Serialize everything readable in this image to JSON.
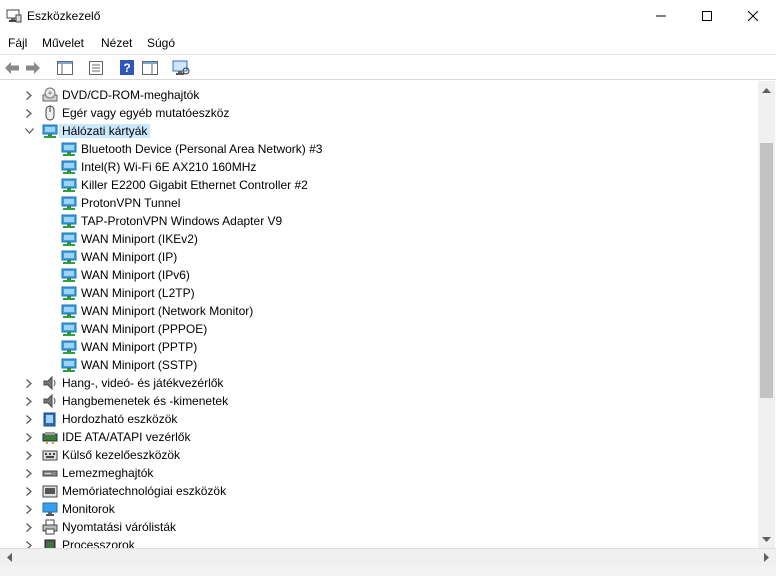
{
  "window": {
    "title": "Eszközkezelő"
  },
  "menu": {
    "file": "Fájl",
    "action": "Művelet",
    "view": "Nézet",
    "help": "Súgó"
  },
  "tree": [
    {
      "label": "DVD/CD-ROM-meghajtók",
      "level": 1,
      "expander": "collapsed",
      "icon": "dvd-drive-icon"
    },
    {
      "label": "Egér vagy egyéb mutatóeszköz",
      "level": 1,
      "expander": "collapsed",
      "icon": "mouse-icon"
    },
    {
      "label": "Hálózati kártyák",
      "level": 1,
      "expander": "expanded",
      "icon": "network-adapter-icon",
      "selected": true
    },
    {
      "label": "Bluetooth Device (Personal Area Network) #3",
      "level": 2,
      "icon": "network-adapter-icon"
    },
    {
      "label": "Intel(R) Wi-Fi 6E AX210 160MHz",
      "level": 2,
      "icon": "network-adapter-icon"
    },
    {
      "label": "Killer E2200 Gigabit Ethernet Controller #2",
      "level": 2,
      "icon": "network-adapter-icon"
    },
    {
      "label": "ProtonVPN Tunnel",
      "level": 2,
      "icon": "network-adapter-icon"
    },
    {
      "label": "TAP-ProtonVPN Windows Adapter V9",
      "level": 2,
      "icon": "network-adapter-icon"
    },
    {
      "label": "WAN Miniport (IKEv2)",
      "level": 2,
      "icon": "network-adapter-icon"
    },
    {
      "label": "WAN Miniport (IP)",
      "level": 2,
      "icon": "network-adapter-icon"
    },
    {
      "label": "WAN Miniport (IPv6)",
      "level": 2,
      "icon": "network-adapter-icon"
    },
    {
      "label": "WAN Miniport (L2TP)",
      "level": 2,
      "icon": "network-adapter-icon"
    },
    {
      "label": "WAN Miniport (Network Monitor)",
      "level": 2,
      "icon": "network-adapter-icon"
    },
    {
      "label": "WAN Miniport (PPPOE)",
      "level": 2,
      "icon": "network-adapter-icon"
    },
    {
      "label": "WAN Miniport (PPTP)",
      "level": 2,
      "icon": "network-adapter-icon"
    },
    {
      "label": "WAN Miniport (SSTP)",
      "level": 2,
      "icon": "network-adapter-icon"
    },
    {
      "label": "Hang-, videó- és játékvezérlők",
      "level": 1,
      "expander": "collapsed",
      "icon": "speaker-icon"
    },
    {
      "label": "Hangbemenetek és -kimenetek",
      "level": 1,
      "expander": "collapsed",
      "icon": "speaker-icon"
    },
    {
      "label": "Hordozható eszközök",
      "level": 1,
      "expander": "collapsed",
      "icon": "portable-device-icon"
    },
    {
      "label": "IDE ATA/ATAPI vezérlők",
      "level": 1,
      "expander": "collapsed",
      "icon": "ide-controller-icon"
    },
    {
      "label": "Külső kezelőeszközök",
      "level": 1,
      "expander": "collapsed",
      "icon": "keyboard-icon"
    },
    {
      "label": "Lemezmeghajtók",
      "level": 1,
      "expander": "collapsed",
      "icon": "disk-drive-icon"
    },
    {
      "label": "Memóriatechnológiai eszközök",
      "level": 1,
      "expander": "collapsed",
      "icon": "memory-device-icon"
    },
    {
      "label": "Monitorok",
      "level": 1,
      "expander": "collapsed",
      "icon": "monitor-icon"
    },
    {
      "label": "Nyomtatási várólisták",
      "level": 1,
      "expander": "collapsed",
      "icon": "printer-icon"
    },
    {
      "label": "Processzorok",
      "level": 1,
      "expander": "collapsed",
      "icon": "processor-icon"
    }
  ]
}
